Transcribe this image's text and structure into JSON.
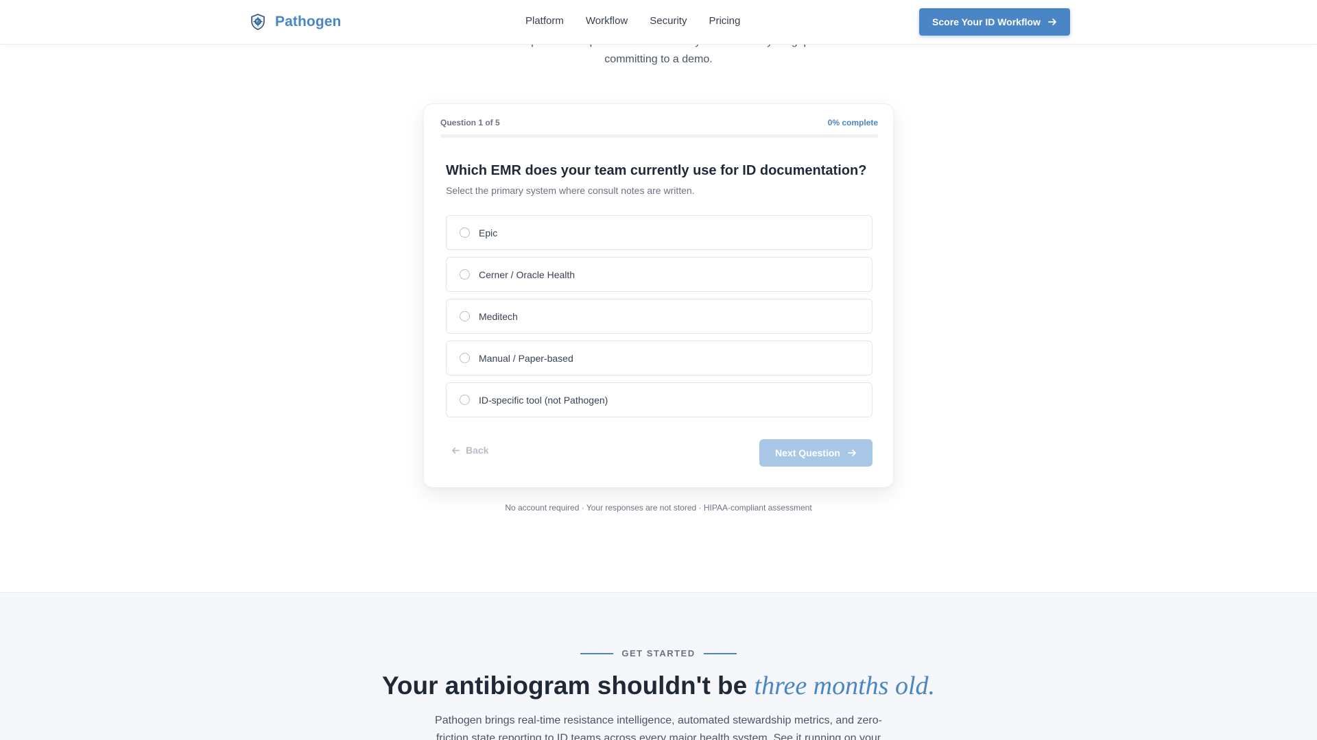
{
  "header": {
    "brand": "Pathogen",
    "nav": [
      "Platform",
      "Workflow",
      "Security",
      "Pricing"
    ],
    "cta_label": "Score Your ID Workflow"
  },
  "intro": {
    "text": "Five clinical questions. A personalized efficiency score. Know your gaps before committing to a demo."
  },
  "quiz": {
    "question_count": "Question 1 of 5",
    "percent_label": "0% complete",
    "progress_fraction": 0,
    "question": "Which EMR does your team currently use for ID documentation?",
    "subtitle": "Select the primary system where consult notes are written.",
    "options": [
      "Epic",
      "Cerner / Oracle Health",
      "Meditech",
      "Manual / Paper-based",
      "ID-specific tool (not Pathogen)"
    ],
    "back_label": "Back",
    "next_label": "Next Question"
  },
  "footnote": "No account required · Your responses are not stored · HIPAA-compliant assessment",
  "get_started": {
    "eyebrow": "GET STARTED",
    "headline_prefix": "Your antibiogram shouldn't be",
    "headline_accent": "three months old.",
    "body": "Pathogen brings real-time resistance intelligence, automated stewardship metrics, and zero-friction state reporting to ID teams across every major health system. See it running on your"
  },
  "colors": {
    "brand": "#4a86c5",
    "next_disabled": "#a9c7e7",
    "section_bg": "#f5f7fa"
  },
  "icons": {
    "logo": "shield-microbe-icon",
    "cta": "arrow-right-icon",
    "back": "arrow-left-icon",
    "next": "arrow-right-icon"
  }
}
